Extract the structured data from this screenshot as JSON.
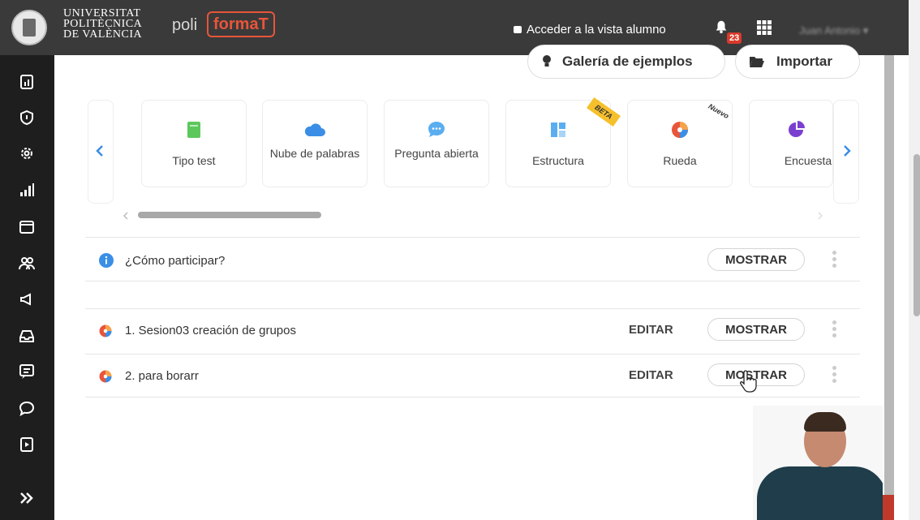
{
  "header": {
    "university_line1": "UNIVERSITAT",
    "university_line2": "POLITÈCNICA",
    "university_line3": "DE VALÈNCIA",
    "brand_poli": "poli",
    "brand_format": "formaT",
    "student_view_label": "Acceder a la vista alumno",
    "notification_count": "23",
    "user_name": "Juan Antonio"
  },
  "toolbar": {
    "gallery_label": "Galería de ejemplos",
    "import_label": "Importar"
  },
  "question_types": [
    {
      "label": "Tipo test",
      "icon": "quiz-icon",
      "color": "#5cc85c",
      "tag": ""
    },
    {
      "label": "Nube de palabras",
      "icon": "cloud-icon",
      "color": "#3a8ee6",
      "tag": ""
    },
    {
      "label": "Pregunta abierta",
      "icon": "chat-bubble-icon",
      "color": "#5aaef0",
      "tag": ""
    },
    {
      "label": "Estructura",
      "icon": "structure-icon",
      "color": "#5aaef0",
      "tag": "BETA"
    },
    {
      "label": "Rueda",
      "icon": "wheel-icon",
      "color": "#e8553a",
      "tag": "Nuevo"
    },
    {
      "label": "Encuesta",
      "icon": "pie-icon",
      "color": "#7b3fd0",
      "tag": ""
    }
  ],
  "how_to": {
    "label": "¿Cómo participar?",
    "show_label": "MOSTRAR"
  },
  "activities": [
    {
      "label": "1. Sesion03 creación de grupos",
      "edit_label": "EDITAR",
      "show_label": "MOSTRAR"
    },
    {
      "label": "2. para borarr",
      "edit_label": "EDITAR",
      "show_label": "MOSTRAR"
    }
  ],
  "colors": {
    "topbar": "#3a3a3a",
    "sidebar": "#1e1e1e",
    "accent": "#e8553a",
    "info": "#3a8ee6"
  }
}
